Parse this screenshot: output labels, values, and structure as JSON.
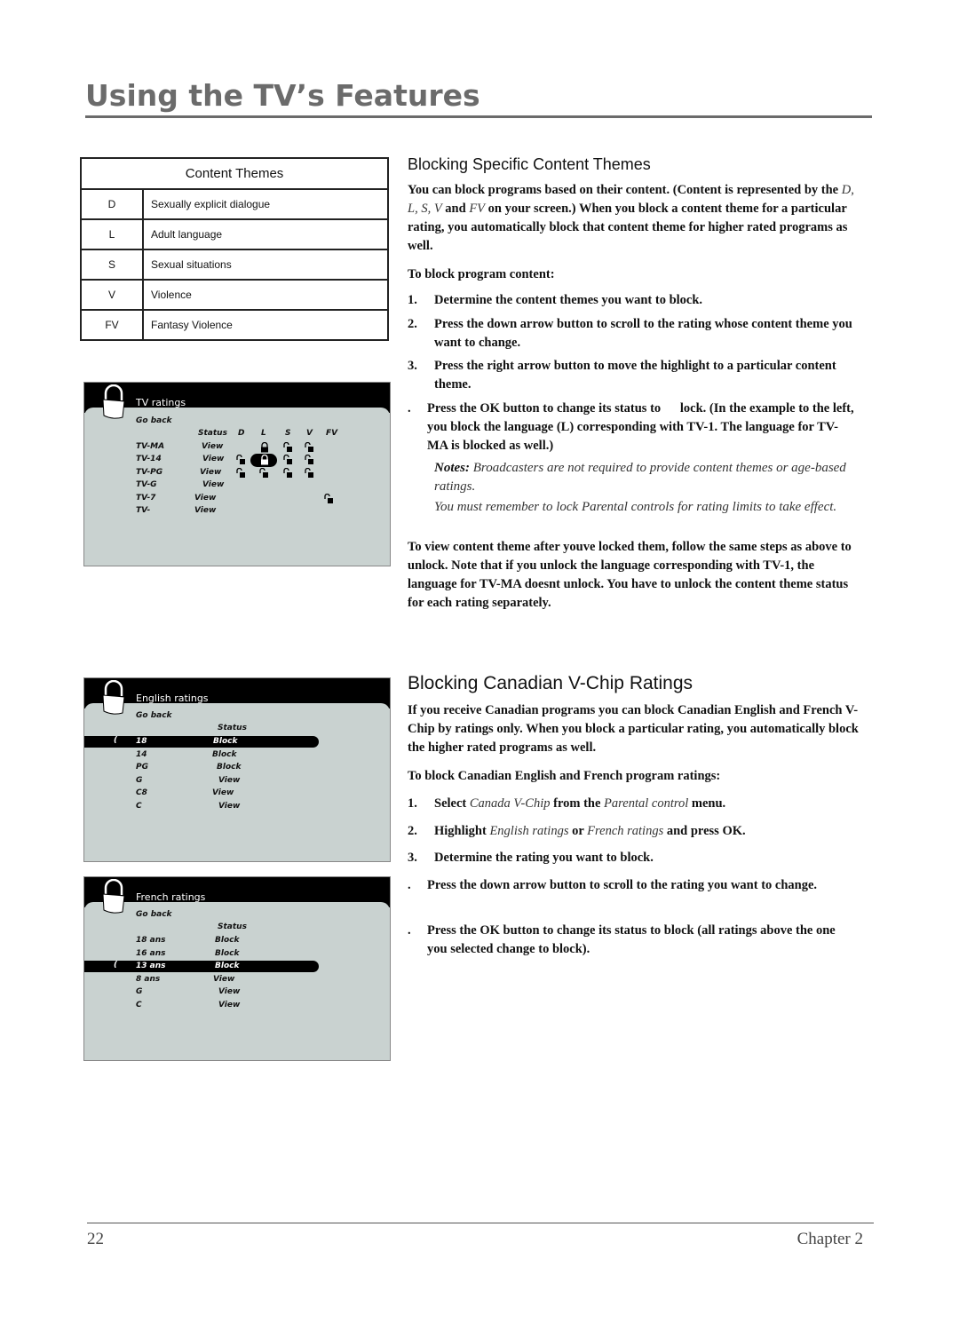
{
  "header": {
    "title": "Using the TV’s Features"
  },
  "content_themes_table": {
    "heading": "Content Themes",
    "rows": [
      {
        "code": "D",
        "description": "Sexually explicit dialogue"
      },
      {
        "code": "L",
        "description": "Adult language"
      },
      {
        "code": "S",
        "description": "Sexual situations"
      },
      {
        "code": "V",
        "description": "Violence"
      },
      {
        "code": "FV",
        "description": "Fantasy Violence"
      }
    ]
  },
  "tv_ratings_screen": {
    "title": "TV ratings",
    "go_back": "Go back",
    "columns": [
      "Status",
      "D",
      "L",
      "S",
      "V",
      "FV"
    ],
    "rows": [
      {
        "rating": "TV-MA",
        "status": "View",
        "locks": {
          "L": "locked",
          "S": "unlocked",
          "V": "unlocked"
        }
      },
      {
        "rating": "TV-14",
        "status": "View",
        "locks": {
          "D": "unlocked",
          "L": "locked-selected",
          "S": "unlocked",
          "V": "unlocked"
        }
      },
      {
        "rating": "TV-PG",
        "status": "View",
        "locks": {
          "D": "unlocked",
          "L": "unlocked",
          "S": "unlocked",
          "V": "unlocked"
        }
      },
      {
        "rating": "TV-G",
        "status": "View",
        "locks": {}
      },
      {
        "rating": "TV-7",
        "status": "View",
        "locks": {
          "FV": "unlocked"
        }
      },
      {
        "rating": "TV-",
        "status": "View",
        "locks": {}
      }
    ]
  },
  "english_ratings_screen": {
    "title": "English ratings",
    "go_back": "Go back",
    "status_header": "Status",
    "selected_index": 0,
    "rows": [
      {
        "rating": "18",
        "status": "Block"
      },
      {
        "rating": "14",
        "status": "Block"
      },
      {
        "rating": "PG",
        "status": "Block"
      },
      {
        "rating": "G",
        "status": "View"
      },
      {
        "rating": "C8",
        "status": "View"
      },
      {
        "rating": "C",
        "status": "View"
      }
    ],
    "cursor": "("
  },
  "french_ratings_screen": {
    "title": "French ratings",
    "go_back": "Go back",
    "status_header": "Status",
    "selected_index": 2,
    "rows": [
      {
        "rating": "18 ans",
        "status": "Block"
      },
      {
        "rating": "16 ans",
        "status": "Block"
      },
      {
        "rating": "13 ans",
        "status": "Block"
      },
      {
        "rating": "8 ans",
        "status": "View"
      },
      {
        "rating": "G",
        "status": "View"
      },
      {
        "rating": "C",
        "status": "View"
      }
    ],
    "cursor": "("
  },
  "section1": {
    "heading": "Blocking Specific Content Themes",
    "intro_a": "You can block programs based on their content. (Content is represented by the ",
    "intro_codes": "D, L, S, V",
    "intro_b": " and ",
    "intro_fv": "FV",
    "intro_c": " on your screen.) When you block a content theme for a particular rating, you automatically block that content theme for higher rated programs as well.",
    "lead": "To block program content:",
    "steps": [
      {
        "num": "1.",
        "text": "Determine the content themes you want to block."
      },
      {
        "num": "2.",
        "text": "Press the down arrow button to scroll to the rating whose content theme you want to change."
      },
      {
        "num": "3.",
        "text": "Press the right arrow button to move the highlight to a particular content theme."
      },
      {
        "num": ".",
        "text": "Press the OK button to change its status to      lock. (In the example to the left, you block the language (L) corresponding with TV-1. The language for TV-MA is blocked as well.)"
      }
    ],
    "notes_label": "Notes:",
    "note1": " Broadcasters are not required to provide content themes or age-based ratings.",
    "note2": "You must remember to lock Parental controls for rating limits to take effect.",
    "closing": "To view content theme after youve locked them, follow the same steps as above to unlock. Note that if you unlock the language corresponding with TV-1, the language for TV-MA doesnt unlock. You have to unlock the content theme status for each rating separately."
  },
  "section2": {
    "heading": "Blocking Canadian V-Chip Ratings",
    "intro": "If you receive Canadian programs you can block Canadian English and French V-Chip by ratings only. When you block a particular rating, you automatically block the higher rated programs as well.",
    "lead": "To block Canadian English and French program ratings:",
    "step1": {
      "num": "1.",
      "a": "Select ",
      "b": "Canada V-Chip",
      "c": " from the ",
      "d": "Parental control",
      "e": " menu."
    },
    "step2": {
      "num": "2.",
      "a": "Highlight ",
      "b": "English ratings",
      "c": " or ",
      "d": "French ratings",
      "e": " and press OK."
    },
    "step3": {
      "num": "3.",
      "text": "Determine the rating you want to block."
    },
    "step4": {
      "num": ".",
      "text": "Press the down arrow button to scroll to the rating you want to change."
    },
    "step5": {
      "num": ".",
      "text": "Press the OK button to change its status to block (all ratings above the one you selected change to block)."
    }
  },
  "footer": {
    "page_number": "22",
    "chapter": "Chapter 2"
  }
}
